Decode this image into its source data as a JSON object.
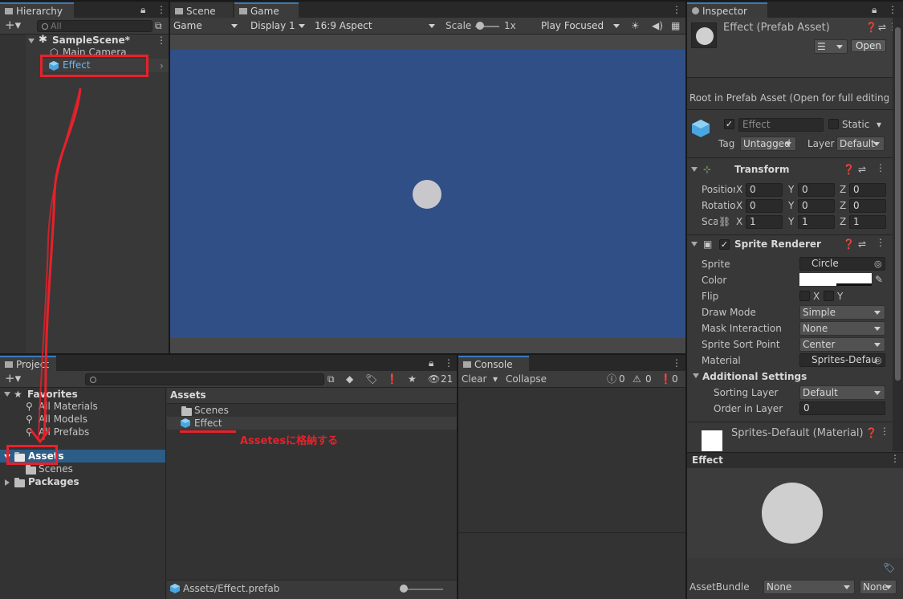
{
  "hierarchy": {
    "tab": "Hierarchy",
    "search_placeholder": "All",
    "scene": "SampleScene*",
    "items": [
      "Main Camera",
      "Effect"
    ]
  },
  "scene_tab": "Scene",
  "game": {
    "tab": "Game",
    "toolbar": {
      "mode": "Game",
      "display": "Display 1",
      "aspect": "16:9 Aspect",
      "scale_label": "Scale",
      "scale_value": "1x",
      "play_mode": "Play Focused"
    },
    "background_color": "#2f4f86",
    "sprite_color": "#c8c8cc"
  },
  "inspector": {
    "tab": "Inspector",
    "asset_title": "Effect (Prefab Asset)",
    "open_button": "Open",
    "root_notice": "Root in Prefab Asset (Open for full editing su",
    "name_value": "Effect",
    "static_label": "Static",
    "tag_label": "Tag",
    "tag_value": "Untagged",
    "layer_label": "Layer",
    "layer_value": "Default",
    "transform": {
      "title": "Transform",
      "rows": [
        {
          "label": "Position",
          "x": "0",
          "y": "0",
          "z": "0"
        },
        {
          "label": "Rotation",
          "x": "0",
          "y": "0",
          "z": "0"
        },
        {
          "label": "Scale",
          "x": "1",
          "y": "1",
          "z": "1"
        }
      ]
    },
    "sprite_renderer": {
      "title": "Sprite Renderer",
      "sprite_label": "Sprite",
      "sprite_value": "Circle",
      "color_label": "Color",
      "flip_label": "Flip",
      "flip_x": "X",
      "flip_y": "Y",
      "draw_mode_label": "Draw Mode",
      "draw_mode_value": "Simple",
      "mask_label": "Mask Interaction",
      "mask_value": "None",
      "sort_point_label": "Sprite Sort Point",
      "sort_point_value": "Center",
      "material_label": "Material",
      "material_value": "Sprites-Defau",
      "additional_title": "Additional Settings",
      "sorting_layer_label": "Sorting Layer",
      "sorting_layer_value": "Default",
      "order_label": "Order in Layer",
      "order_value": "0"
    },
    "material_title": "Sprites-Default (Material)",
    "preview_title": "Effect",
    "assetbundle_label": "AssetBundle",
    "assetbundle_value": "None",
    "assetbundle_variant": "None"
  },
  "project": {
    "tab": "Project",
    "favorites_label": "Favorites",
    "favorites": [
      "All Materials",
      "All Models",
      "All Prefabs"
    ],
    "assets_label": "Assets",
    "scenes_label": "Scenes",
    "packages_label": "Packages",
    "hidden_count": "21",
    "breadcrumb": "Assets",
    "content": [
      "Scenes",
      "Effect"
    ],
    "footer_path": "Assets/Effect.prefab"
  },
  "console": {
    "tab": "Console",
    "clear": "Clear",
    "collapse": "Collapse",
    "log_count": "0",
    "warn_count": "0",
    "error_count": "0"
  },
  "annotation": {
    "text": "Assetesに格納する",
    "color": "#e8212a"
  }
}
